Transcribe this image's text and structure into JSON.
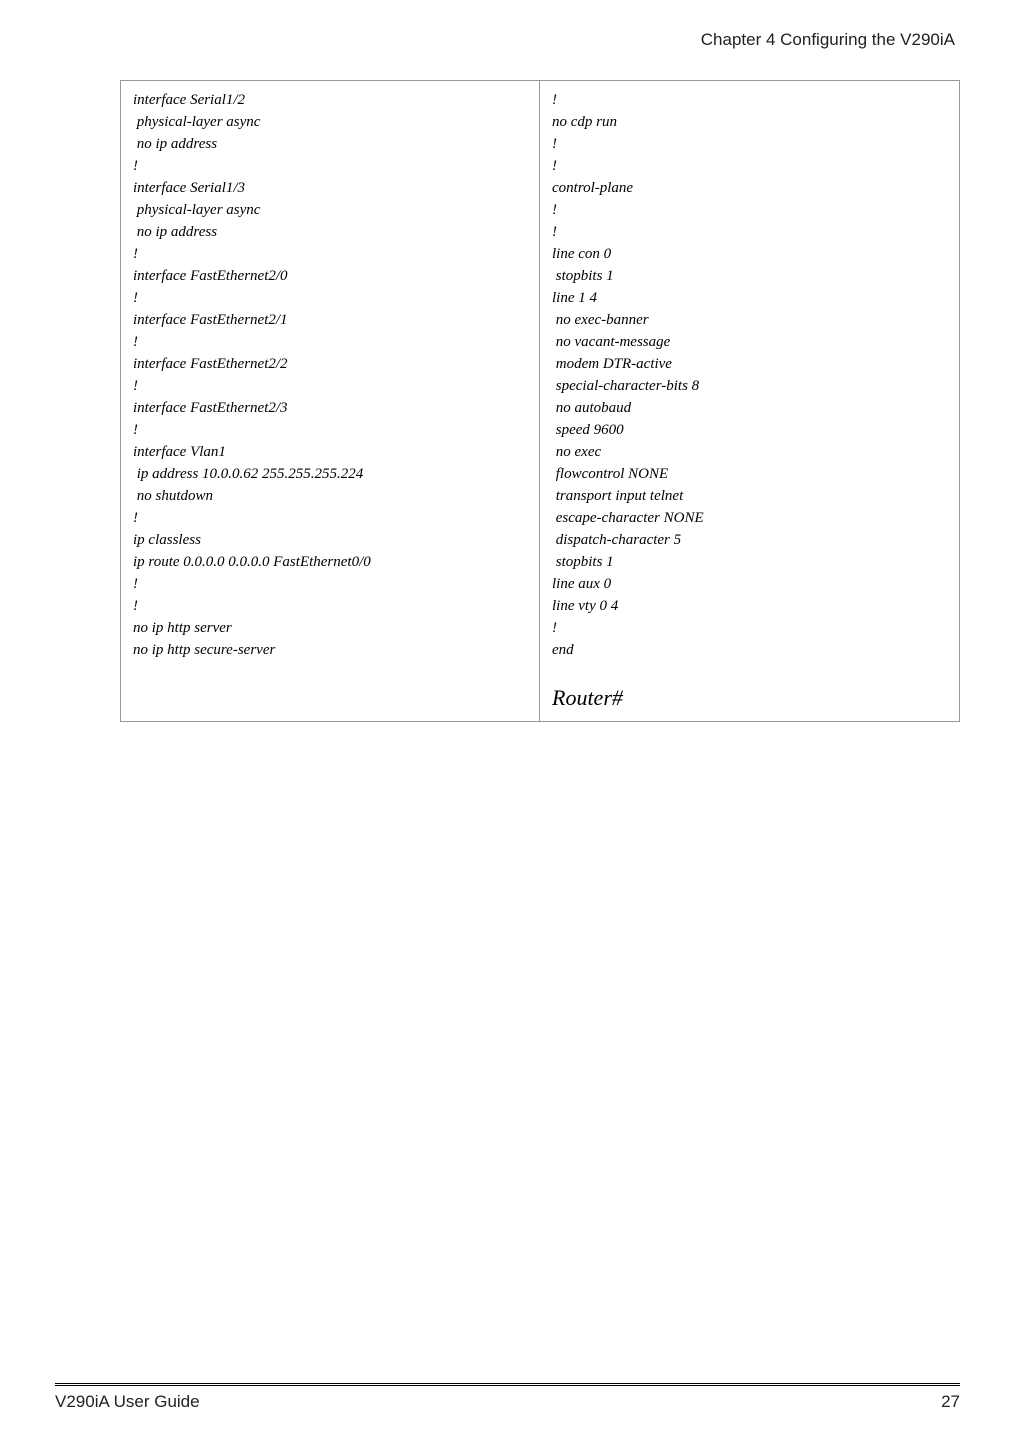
{
  "header": {
    "chapter_label": "Chapter 4  Configuring the V290iA"
  },
  "config": {
    "left_lines": [
      "interface Serial1/2",
      " physical-layer async",
      " no ip address",
      "!",
      "interface Serial1/3",
      " physical-layer async",
      " no ip address",
      "!",
      "interface FastEthernet2/0",
      "!",
      "interface FastEthernet2/1",
      "!",
      "interface FastEthernet2/2",
      "!",
      "interface FastEthernet2/3",
      "!",
      "interface Vlan1",
      " ip address 10.0.0.62 255.255.255.224",
      " no shutdown",
      "!",
      "ip classless",
      "ip route 0.0.0.0 0.0.0.0 FastEthernet0/0",
      "!",
      "!",
      "no ip http server",
      "no ip http secure-server"
    ],
    "right_lines": [
      "!",
      "no cdp run",
      "!",
      "!",
      "control-plane",
      "!",
      "!",
      "line con 0",
      " stopbits 1",
      "line 1 4",
      " no exec-banner",
      " no vacant-message",
      " modem DTR-active",
      " special-character-bits 8",
      " no autobaud",
      " speed 9600",
      " no exec",
      " flowcontrol NONE",
      " transport input telnet",
      " escape-character NONE",
      " dispatch-character 5",
      " stopbits 1",
      "line aux 0",
      "line vty 0 4",
      "!",
      "end"
    ],
    "prompt": "Router#"
  },
  "footer": {
    "guide_label": "V290iA User Guide",
    "page_number": "27"
  }
}
